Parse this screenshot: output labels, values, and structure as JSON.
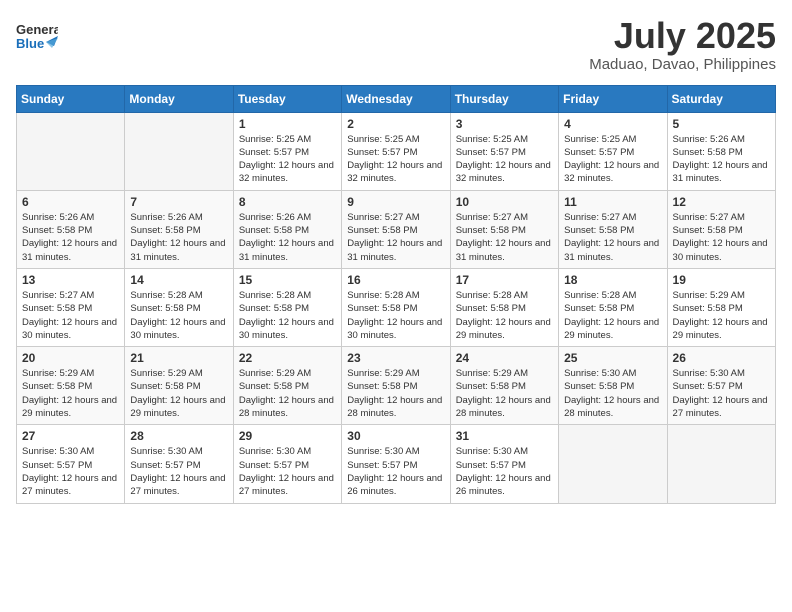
{
  "logo": {
    "line1": "General",
    "line2": "Blue"
  },
  "title": "July 2025",
  "location": "Maduao, Davao, Philippines",
  "weekdays": [
    "Sunday",
    "Monday",
    "Tuesday",
    "Wednesday",
    "Thursday",
    "Friday",
    "Saturday"
  ],
  "weeks": [
    [
      {
        "day": "",
        "sunrise": "",
        "sunset": "",
        "daylight": ""
      },
      {
        "day": "",
        "sunrise": "",
        "sunset": "",
        "daylight": ""
      },
      {
        "day": "1",
        "sunrise": "Sunrise: 5:25 AM",
        "sunset": "Sunset: 5:57 PM",
        "daylight": "Daylight: 12 hours and 32 minutes."
      },
      {
        "day": "2",
        "sunrise": "Sunrise: 5:25 AM",
        "sunset": "Sunset: 5:57 PM",
        "daylight": "Daylight: 12 hours and 32 minutes."
      },
      {
        "day": "3",
        "sunrise": "Sunrise: 5:25 AM",
        "sunset": "Sunset: 5:57 PM",
        "daylight": "Daylight: 12 hours and 32 minutes."
      },
      {
        "day": "4",
        "sunrise": "Sunrise: 5:25 AM",
        "sunset": "Sunset: 5:57 PM",
        "daylight": "Daylight: 12 hours and 32 minutes."
      },
      {
        "day": "5",
        "sunrise": "Sunrise: 5:26 AM",
        "sunset": "Sunset: 5:58 PM",
        "daylight": "Daylight: 12 hours and 31 minutes."
      }
    ],
    [
      {
        "day": "6",
        "sunrise": "Sunrise: 5:26 AM",
        "sunset": "Sunset: 5:58 PM",
        "daylight": "Daylight: 12 hours and 31 minutes."
      },
      {
        "day": "7",
        "sunrise": "Sunrise: 5:26 AM",
        "sunset": "Sunset: 5:58 PM",
        "daylight": "Daylight: 12 hours and 31 minutes."
      },
      {
        "day": "8",
        "sunrise": "Sunrise: 5:26 AM",
        "sunset": "Sunset: 5:58 PM",
        "daylight": "Daylight: 12 hours and 31 minutes."
      },
      {
        "day": "9",
        "sunrise": "Sunrise: 5:27 AM",
        "sunset": "Sunset: 5:58 PM",
        "daylight": "Daylight: 12 hours and 31 minutes."
      },
      {
        "day": "10",
        "sunrise": "Sunrise: 5:27 AM",
        "sunset": "Sunset: 5:58 PM",
        "daylight": "Daylight: 12 hours and 31 minutes."
      },
      {
        "day": "11",
        "sunrise": "Sunrise: 5:27 AM",
        "sunset": "Sunset: 5:58 PM",
        "daylight": "Daylight: 12 hours and 31 minutes."
      },
      {
        "day": "12",
        "sunrise": "Sunrise: 5:27 AM",
        "sunset": "Sunset: 5:58 PM",
        "daylight": "Daylight: 12 hours and 30 minutes."
      }
    ],
    [
      {
        "day": "13",
        "sunrise": "Sunrise: 5:27 AM",
        "sunset": "Sunset: 5:58 PM",
        "daylight": "Daylight: 12 hours and 30 minutes."
      },
      {
        "day": "14",
        "sunrise": "Sunrise: 5:28 AM",
        "sunset": "Sunset: 5:58 PM",
        "daylight": "Daylight: 12 hours and 30 minutes."
      },
      {
        "day": "15",
        "sunrise": "Sunrise: 5:28 AM",
        "sunset": "Sunset: 5:58 PM",
        "daylight": "Daylight: 12 hours and 30 minutes."
      },
      {
        "day": "16",
        "sunrise": "Sunrise: 5:28 AM",
        "sunset": "Sunset: 5:58 PM",
        "daylight": "Daylight: 12 hours and 30 minutes."
      },
      {
        "day": "17",
        "sunrise": "Sunrise: 5:28 AM",
        "sunset": "Sunset: 5:58 PM",
        "daylight": "Daylight: 12 hours and 29 minutes."
      },
      {
        "day": "18",
        "sunrise": "Sunrise: 5:28 AM",
        "sunset": "Sunset: 5:58 PM",
        "daylight": "Daylight: 12 hours and 29 minutes."
      },
      {
        "day": "19",
        "sunrise": "Sunrise: 5:29 AM",
        "sunset": "Sunset: 5:58 PM",
        "daylight": "Daylight: 12 hours and 29 minutes."
      }
    ],
    [
      {
        "day": "20",
        "sunrise": "Sunrise: 5:29 AM",
        "sunset": "Sunset: 5:58 PM",
        "daylight": "Daylight: 12 hours and 29 minutes."
      },
      {
        "day": "21",
        "sunrise": "Sunrise: 5:29 AM",
        "sunset": "Sunset: 5:58 PM",
        "daylight": "Daylight: 12 hours and 29 minutes."
      },
      {
        "day": "22",
        "sunrise": "Sunrise: 5:29 AM",
        "sunset": "Sunset: 5:58 PM",
        "daylight": "Daylight: 12 hours and 28 minutes."
      },
      {
        "day": "23",
        "sunrise": "Sunrise: 5:29 AM",
        "sunset": "Sunset: 5:58 PM",
        "daylight": "Daylight: 12 hours and 28 minutes."
      },
      {
        "day": "24",
        "sunrise": "Sunrise: 5:29 AM",
        "sunset": "Sunset: 5:58 PM",
        "daylight": "Daylight: 12 hours and 28 minutes."
      },
      {
        "day": "25",
        "sunrise": "Sunrise: 5:30 AM",
        "sunset": "Sunset: 5:58 PM",
        "daylight": "Daylight: 12 hours and 28 minutes."
      },
      {
        "day": "26",
        "sunrise": "Sunrise: 5:30 AM",
        "sunset": "Sunset: 5:57 PM",
        "daylight": "Daylight: 12 hours and 27 minutes."
      }
    ],
    [
      {
        "day": "27",
        "sunrise": "Sunrise: 5:30 AM",
        "sunset": "Sunset: 5:57 PM",
        "daylight": "Daylight: 12 hours and 27 minutes."
      },
      {
        "day": "28",
        "sunrise": "Sunrise: 5:30 AM",
        "sunset": "Sunset: 5:57 PM",
        "daylight": "Daylight: 12 hours and 27 minutes."
      },
      {
        "day": "29",
        "sunrise": "Sunrise: 5:30 AM",
        "sunset": "Sunset: 5:57 PM",
        "daylight": "Daylight: 12 hours and 27 minutes."
      },
      {
        "day": "30",
        "sunrise": "Sunrise: 5:30 AM",
        "sunset": "Sunset: 5:57 PM",
        "daylight": "Daylight: 12 hours and 26 minutes."
      },
      {
        "day": "31",
        "sunrise": "Sunrise: 5:30 AM",
        "sunset": "Sunset: 5:57 PM",
        "daylight": "Daylight: 12 hours and 26 minutes."
      },
      {
        "day": "",
        "sunrise": "",
        "sunset": "",
        "daylight": ""
      },
      {
        "day": "",
        "sunrise": "",
        "sunset": "",
        "daylight": ""
      }
    ]
  ]
}
